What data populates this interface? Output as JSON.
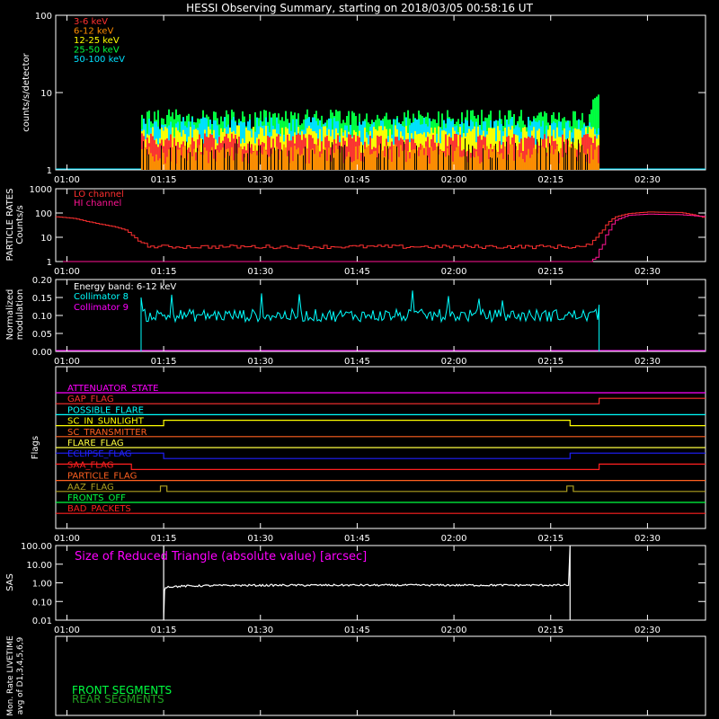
{
  "title": "HESSI Observing Summary, starting on 2018/03/05 00:58:16 UT",
  "time_ticks": [
    "01:00",
    "01:15",
    "01:30",
    "01:45",
    "02:00",
    "02:15",
    "02:30"
  ],
  "chart_data": [
    {
      "type": "area",
      "name": "count-rates",
      "ylabel": "counts/s/detector",
      "y_scale": "log",
      "ylim": [
        1,
        100
      ],
      "y_ticks": [
        "1",
        "10",
        "100"
      ],
      "xlim": [
        "00:58:16",
        "02:39:00"
      ],
      "data_start": "01:11:30",
      "data_end": "02:22:30",
      "series": [
        {
          "name": "3-6 keV",
          "color": "#ff3030",
          "level": 2.2
        },
        {
          "name": "6-12 keV",
          "color": "#ff8c00",
          "level": 1.6
        },
        {
          "name": "12-25 keV",
          "color": "#ffff00",
          "level": 2.8
        },
        {
          "name": "25-50 keV",
          "color": "#00ff40",
          "level": 4.5
        },
        {
          "name": "50-100 keV",
          "color": "#00e0ff",
          "level": 3.6
        }
      ],
      "end_spike": 9.5
    },
    {
      "type": "line",
      "name": "particle-rates",
      "ylabel_lines": [
        "PARTICLE RATES",
        "Counts/s"
      ],
      "y_scale": "log",
      "ylim": [
        1,
        1000
      ],
      "y_ticks": [
        "1",
        "10",
        "100",
        "1000"
      ],
      "series": [
        {
          "name": "LO channel",
          "color": "#ff3030"
        },
        {
          "name": "HI channel",
          "color": "#ff1493"
        }
      ],
      "lo_points": [
        [
          "00:58:16",
          70
        ],
        [
          "01:01",
          60
        ],
        [
          "01:03",
          45
        ],
        [
          "01:05",
          35
        ],
        [
          "01:07",
          28
        ],
        [
          "01:09",
          20
        ],
        [
          "01:10",
          12
        ],
        [
          "01:11",
          7
        ],
        [
          "01:12",
          5
        ],
        [
          "01:13",
          4
        ],
        [
          "02:20",
          4
        ],
        [
          "02:21",
          5
        ],
        [
          "02:22",
          10
        ],
        [
          "02:23",
          20
        ],
        [
          "02:24",
          45
        ],
        [
          "02:25",
          70
        ],
        [
          "02:27",
          95
        ],
        [
          "02:30",
          110
        ],
        [
          "02:35",
          105
        ],
        [
          "02:37",
          85
        ],
        [
          "02:39",
          60
        ]
      ],
      "hi_points": [
        [
          "00:58:16",
          1
        ],
        [
          "02:21",
          1
        ],
        [
          "02:22",
          1.5
        ],
        [
          "02:23",
          5
        ],
        [
          "02:24",
          20
        ],
        [
          "02:25",
          50
        ],
        [
          "02:27",
          80
        ],
        [
          "02:30",
          90
        ],
        [
          "02:35",
          85
        ],
        [
          "02:39",
          70
        ]
      ]
    },
    {
      "type": "line",
      "name": "modulation",
      "ylabel_lines": [
        "Normalized",
        "modulation"
      ],
      "ylim": [
        0,
        0.2
      ],
      "y_ticks": [
        "0.00",
        "0.05",
        "0.10",
        "0.15",
        "0.20"
      ],
      "annotation": "Energy band: 6-12 keV",
      "series": [
        {
          "name": "Collimator 8",
          "color": "#00ffff",
          "mean": 0.1
        },
        {
          "name": "Collimator 9",
          "color": "#ff00ff",
          "value": 0
        }
      ]
    },
    {
      "type": "line",
      "name": "flags",
      "ylabel": "Flags",
      "flags": [
        {
          "name": "ATTENUATOR_STATE",
          "color": "#ff00ff",
          "segments": [
            [
              "00:58:16",
              "02:39:00",
              0
            ]
          ]
        },
        {
          "name": "GAP_FLAG",
          "color": "#ff3030",
          "segments": [
            [
              "00:58:16",
              "02:22:30",
              0
            ],
            [
              "02:22:30",
              "02:39:00",
              1
            ]
          ]
        },
        {
          "name": "POSSIBLE_FLARE",
          "color": "#00ffff",
          "segments": [
            [
              "00:58:16",
              "02:39:00",
              0
            ]
          ]
        },
        {
          "name": "SC_IN_SUNLIGHT",
          "color": "#ffff00",
          "segments": [
            [
              "00:58:16",
              "01:15:00",
              0
            ],
            [
              "01:15:00",
              "02:18:00",
              1
            ],
            [
              "02:18:00",
              "02:39:00",
              0
            ]
          ]
        },
        {
          "name": "SC_TRANSMITTER",
          "color": "#ff6020",
          "segments": [
            [
              "00:58:16",
              "02:39:00",
              0
            ]
          ]
        },
        {
          "name": "FLARE_FLAG",
          "color": "#ffff40",
          "segments": [
            [
              "00:58:16",
              "02:39:00",
              0
            ]
          ]
        },
        {
          "name": "ECLIPSE_FLAG",
          "color": "#2020ff",
          "segments": [
            [
              "00:58:16",
              "01:15:00",
              1
            ],
            [
              "01:15:00",
              "02:18:00",
              0
            ],
            [
              "02:18:00",
              "02:39:00",
              1
            ]
          ]
        },
        {
          "name": "SAA_FLAG",
          "color": "#ff2020",
          "segments": [
            [
              "00:58:16",
              "01:10:00",
              1
            ],
            [
              "01:10:00",
              "02:22:30",
              0
            ],
            [
              "02:22:30",
              "02:39:00",
              1
            ]
          ]
        },
        {
          "name": "PARTICLE_FLAG",
          "color": "#ff6020",
          "segments": [
            [
              "00:58:16",
              "02:39:00",
              0
            ]
          ]
        },
        {
          "name": "AAZ_FLAG",
          "color": "#b0a020",
          "segments": [
            [
              "00:58:16",
              "01:14:30",
              0
            ],
            [
              "01:14:30",
              "01:15:30",
              1
            ],
            [
              "01:15:30",
              "02:17:30",
              0
            ],
            [
              "02:17:30",
              "02:18:30",
              1
            ],
            [
              "02:18:30",
              "02:39:00",
              0
            ]
          ]
        },
        {
          "name": "FRONTS_OFF",
          "color": "#00ff40",
          "segments": [
            [
              "00:58:16",
              "02:39:00",
              0
            ]
          ]
        },
        {
          "name": "BAD_PACKETS",
          "color": "#ff2020",
          "segments": [
            [
              "00:58:16",
              "02:39:00",
              0
            ]
          ]
        }
      ]
    },
    {
      "type": "line",
      "name": "sas",
      "ylabel": "SAS",
      "y_scale": "log",
      "ylim": [
        0.01,
        100
      ],
      "y_ticks": [
        "0.01",
        "0.10",
        "1.00",
        "10.00",
        "100.00"
      ],
      "annotation": "Size of Reduced Triangle (absolute value) [arcsec]",
      "annotation_color": "#ff00ff",
      "line_color": "#ffffff",
      "start": "01:15:00",
      "end": "02:18:00",
      "level": 0.75
    },
    {
      "type": "line",
      "name": "livetime",
      "ylabel_lines": [
        "Mon. Rate LIVETIME",
        "avg of D1,3,4,5,6,9"
      ],
      "series": [
        {
          "name": "FRONT SEGMENTS",
          "color": "#00ff40"
        },
        {
          "name": "REAR SEGMENTS",
          "color": "#20a020"
        }
      ]
    }
  ]
}
